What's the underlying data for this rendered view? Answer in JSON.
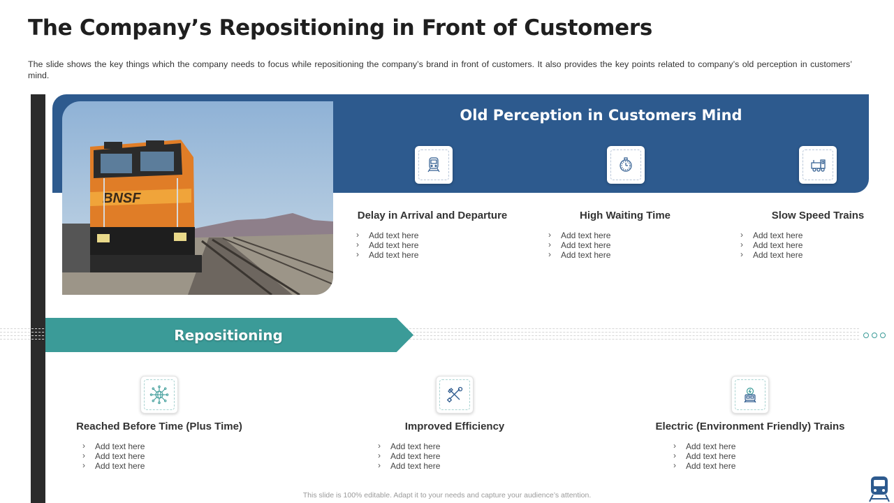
{
  "title": "The Company’s Repositioning in Front of Customers",
  "subtitle": "The slide shows the key things which the company needs to focus while repositioning the company’s brand in front of customers. It also provides the key points related to company’s old perception in customers’ mind.",
  "old_perception": {
    "heading": "Old Perception in Customers Mind",
    "items": [
      {
        "title": "Delay in Arrival and Departure",
        "icon": "train-front-icon",
        "bullets": [
          "Add text here",
          "Add text here",
          "Add text here"
        ]
      },
      {
        "title": "High Waiting Time",
        "icon": "stopwatch-icon",
        "bullets": [
          "Add text here",
          "Add text here",
          "Add text here"
        ]
      },
      {
        "title": "Slow Speed Trains",
        "icon": "locomotive-icon",
        "bullets": [
          "Add text here",
          "Add text here",
          "Add text here"
        ]
      }
    ]
  },
  "repositioning": {
    "heading": "Repositioning",
    "items": [
      {
        "title": "Reached Before Time (Plus Time)",
        "icon": "network-globe-icon",
        "bullets": [
          "Add text here",
          "Add text here",
          "Add text here"
        ]
      },
      {
        "title": "Improved Efficiency",
        "icon": "tools-icon",
        "bullets": [
          "Add text here",
          "Add text here",
          "Add text here"
        ]
      },
      {
        "title": "Electric (Environment Friendly) Trains",
        "icon": "electric-train-icon",
        "bullets": [
          "Add text here",
          "Add text here",
          "Add text here"
        ]
      }
    ]
  },
  "footer": "This slide is 100% editable. Adapt it to your needs and capture your audience’s attention.",
  "colors": {
    "panel_blue": "#2d5a8e",
    "teal": "#3b9b98",
    "dark_bar": "#2b2b2b"
  }
}
